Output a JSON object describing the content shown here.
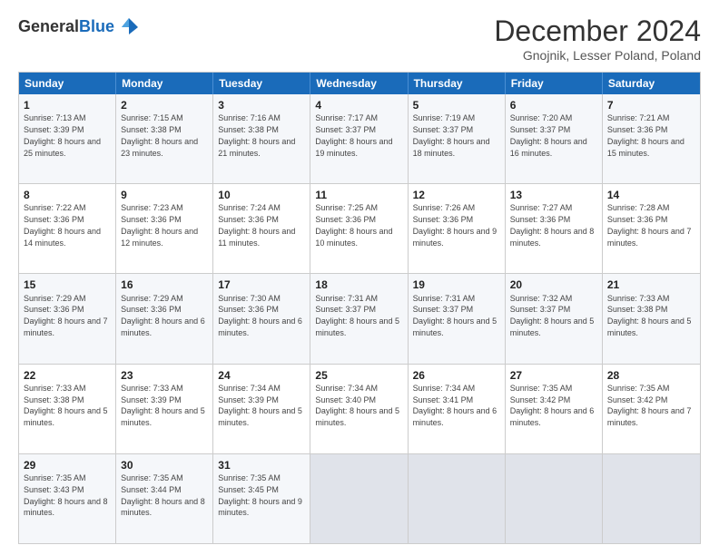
{
  "header": {
    "logo_general": "General",
    "logo_blue": "Blue",
    "month_title": "December 2024",
    "location": "Gnojnik, Lesser Poland, Poland"
  },
  "weekdays": [
    "Sunday",
    "Monday",
    "Tuesday",
    "Wednesday",
    "Thursday",
    "Friday",
    "Saturday"
  ],
  "weeks": [
    [
      {
        "day": "1",
        "sunrise": "7:13 AM",
        "sunset": "3:39 PM",
        "daylight": "8 hours and 25 minutes"
      },
      {
        "day": "2",
        "sunrise": "7:15 AM",
        "sunset": "3:38 PM",
        "daylight": "8 hours and 23 minutes"
      },
      {
        "day": "3",
        "sunrise": "7:16 AM",
        "sunset": "3:38 PM",
        "daylight": "8 hours and 21 minutes"
      },
      {
        "day": "4",
        "sunrise": "7:17 AM",
        "sunset": "3:37 PM",
        "daylight": "8 hours and 19 minutes"
      },
      {
        "day": "5",
        "sunrise": "7:19 AM",
        "sunset": "3:37 PM",
        "daylight": "8 hours and 18 minutes"
      },
      {
        "day": "6",
        "sunrise": "7:20 AM",
        "sunset": "3:37 PM",
        "daylight": "8 hours and 16 minutes"
      },
      {
        "day": "7",
        "sunrise": "7:21 AM",
        "sunset": "3:36 PM",
        "daylight": "8 hours and 15 minutes"
      }
    ],
    [
      {
        "day": "8",
        "sunrise": "7:22 AM",
        "sunset": "3:36 PM",
        "daylight": "8 hours and 14 minutes"
      },
      {
        "day": "9",
        "sunrise": "7:23 AM",
        "sunset": "3:36 PM",
        "daylight": "8 hours and 12 minutes"
      },
      {
        "day": "10",
        "sunrise": "7:24 AM",
        "sunset": "3:36 PM",
        "daylight": "8 hours and 11 minutes"
      },
      {
        "day": "11",
        "sunrise": "7:25 AM",
        "sunset": "3:36 PM",
        "daylight": "8 hours and 10 minutes"
      },
      {
        "day": "12",
        "sunrise": "7:26 AM",
        "sunset": "3:36 PM",
        "daylight": "8 hours and 9 minutes"
      },
      {
        "day": "13",
        "sunrise": "7:27 AM",
        "sunset": "3:36 PM",
        "daylight": "8 hours and 8 minutes"
      },
      {
        "day": "14",
        "sunrise": "7:28 AM",
        "sunset": "3:36 PM",
        "daylight": "8 hours and 7 minutes"
      }
    ],
    [
      {
        "day": "15",
        "sunrise": "7:29 AM",
        "sunset": "3:36 PM",
        "daylight": "8 hours and 7 minutes"
      },
      {
        "day": "16",
        "sunrise": "7:29 AM",
        "sunset": "3:36 PM",
        "daylight": "8 hours and 6 minutes"
      },
      {
        "day": "17",
        "sunrise": "7:30 AM",
        "sunset": "3:36 PM",
        "daylight": "8 hours and 6 minutes"
      },
      {
        "day": "18",
        "sunrise": "7:31 AM",
        "sunset": "3:37 PM",
        "daylight": "8 hours and 5 minutes"
      },
      {
        "day": "19",
        "sunrise": "7:31 AM",
        "sunset": "3:37 PM",
        "daylight": "8 hours and 5 minutes"
      },
      {
        "day": "20",
        "sunrise": "7:32 AM",
        "sunset": "3:37 PM",
        "daylight": "8 hours and 5 minutes"
      },
      {
        "day": "21",
        "sunrise": "7:33 AM",
        "sunset": "3:38 PM",
        "daylight": "8 hours and 5 minutes"
      }
    ],
    [
      {
        "day": "22",
        "sunrise": "7:33 AM",
        "sunset": "3:38 PM",
        "daylight": "8 hours and 5 minutes"
      },
      {
        "day": "23",
        "sunrise": "7:33 AM",
        "sunset": "3:39 PM",
        "daylight": "8 hours and 5 minutes"
      },
      {
        "day": "24",
        "sunrise": "7:34 AM",
        "sunset": "3:39 PM",
        "daylight": "8 hours and 5 minutes"
      },
      {
        "day": "25",
        "sunrise": "7:34 AM",
        "sunset": "3:40 PM",
        "daylight": "8 hours and 5 minutes"
      },
      {
        "day": "26",
        "sunrise": "7:34 AM",
        "sunset": "3:41 PM",
        "daylight": "8 hours and 6 minutes"
      },
      {
        "day": "27",
        "sunrise": "7:35 AM",
        "sunset": "3:42 PM",
        "daylight": "8 hours and 6 minutes"
      },
      {
        "day": "28",
        "sunrise": "7:35 AM",
        "sunset": "3:42 PM",
        "daylight": "8 hours and 7 minutes"
      }
    ],
    [
      {
        "day": "29",
        "sunrise": "7:35 AM",
        "sunset": "3:43 PM",
        "daylight": "8 hours and 8 minutes"
      },
      {
        "day": "30",
        "sunrise": "7:35 AM",
        "sunset": "3:44 PM",
        "daylight": "8 hours and 8 minutes"
      },
      {
        "day": "31",
        "sunrise": "7:35 AM",
        "sunset": "3:45 PM",
        "daylight": "8 hours and 9 minutes"
      },
      {
        "day": "",
        "sunrise": "",
        "sunset": "",
        "daylight": ""
      },
      {
        "day": "",
        "sunrise": "",
        "sunset": "",
        "daylight": ""
      },
      {
        "day": "",
        "sunrise": "",
        "sunset": "",
        "daylight": ""
      },
      {
        "day": "",
        "sunrise": "",
        "sunset": "",
        "daylight": ""
      }
    ]
  ]
}
